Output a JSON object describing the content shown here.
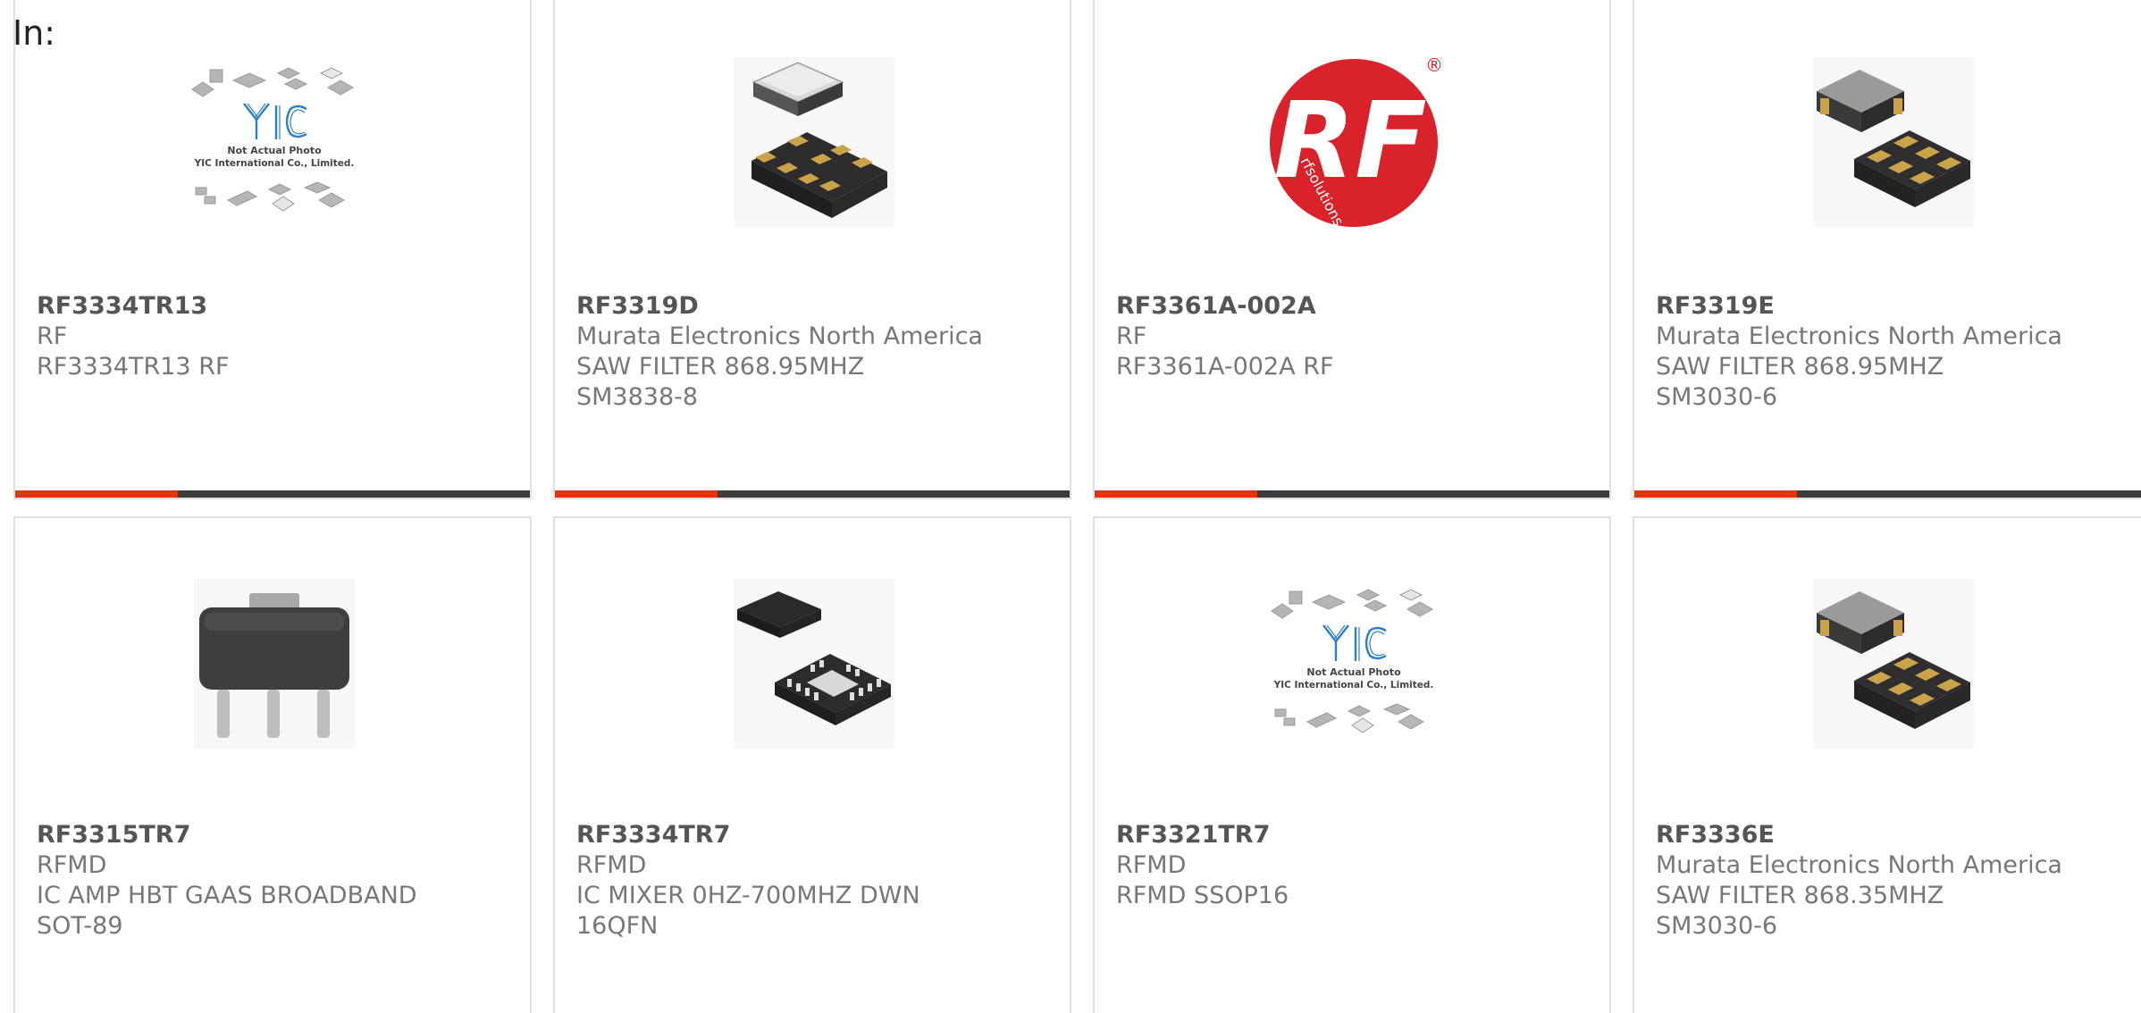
{
  "page": {
    "label": "In:"
  },
  "products": [
    {
      "part_number": "RF3334TR13",
      "manufacturer": "RF",
      "description": "RF3334TR13 RF",
      "package": "",
      "image": "yic-placeholder"
    },
    {
      "part_number": "RF3319D",
      "manufacturer": "Murata Electronics North America",
      "description": "SAW FILTER 868.95MHZ",
      "package": "SM3838-8",
      "image": "saw-filter-8pad"
    },
    {
      "part_number": "RF3361A-002A",
      "manufacturer": "RF",
      "description": "RF3361A-002A RF",
      "package": "",
      "image": "rf-solutions-logo"
    },
    {
      "part_number": "RF3319E",
      "manufacturer": "Murata Electronics North America",
      "description": "SAW FILTER 868.95MHZ",
      "package": "SM3030-6",
      "image": "saw-filter-6pad"
    },
    {
      "part_number": "RF3315TR7",
      "manufacturer": "RFMD",
      "description": "IC AMP HBT GAAS BROADBAND",
      "package": "SOT-89",
      "image": "sot89-package"
    },
    {
      "part_number": "RF3334TR7",
      "manufacturer": "RFMD",
      "description": "IC MIXER 0HZ-700MHZ DWN",
      "package": "16QFN",
      "image": "qfn16-package"
    },
    {
      "part_number": "RF3321TR7",
      "manufacturer": "RFMD",
      "description": "RFMD SSOP16",
      "package": "",
      "image": "yic-placeholder"
    },
    {
      "part_number": "RF3336E",
      "manufacturer": "Murata Electronics North America",
      "description": "SAW FILTER 868.35MHZ",
      "package": "SM3030-6",
      "image": "saw-filter-6pad"
    }
  ],
  "placeholder": {
    "line1": "Not Actual Photo",
    "line2": "YIC International Co., Limited.",
    "logo_text": "YIC"
  },
  "rf_logo": {
    "letters": "RF",
    "tagline": "rfsolutions",
    "mark": "®"
  },
  "colors": {
    "accent": "#e0360f",
    "bar": "#3c3c3c",
    "border": "#e0e0e0",
    "part_number": "#555555",
    "text": "#777777",
    "rf_red": "#d9222a",
    "yic_blue": "#2a7fc8"
  }
}
